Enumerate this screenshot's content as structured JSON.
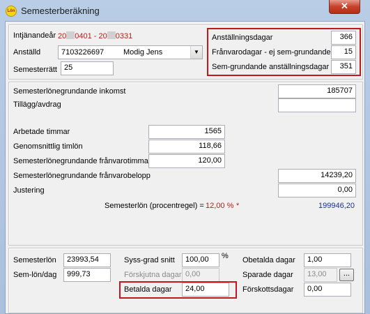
{
  "window": {
    "title": "Semesterberäkning",
    "app_icon_text": "Lön",
    "close_symbol": "✕"
  },
  "header": {
    "intjanandear_label": "Intjänandeår",
    "intjanandear_from": "20",
    "intjanandear_from_suffix": "0401",
    "intjanandear_sep": "-",
    "intjanandear_to": "20",
    "intjanandear_to_suffix": "0331",
    "anstalld_label": "Anställd",
    "anstalld_id": "7103226697",
    "anstalld_name": "Modig Jens",
    "semesterratt_label": "Semesterrätt",
    "semesterratt_value": "25"
  },
  "days": {
    "anstallningsdagar_label": "Anställningsdagar",
    "anstallningsdagar_value": "366",
    "franvarodagar_label": "Frånvarodagar - ej sem-grundande",
    "franvarodagar_value": "15",
    "semgrundande_label": "Sem-grundande anställningsdagar",
    "semgrundande_value": "351"
  },
  "income": {
    "inkomst_label": "Semesterlönegrundande inkomst",
    "inkomst_value": "185707",
    "tillagg_label": "Tillägg/avdrag",
    "tillagg_value": ""
  },
  "hours": {
    "arbetade_label": "Arbetade timmar",
    "arbetade_value": "1565",
    "timlon_label": "Genomsnittlig timlön",
    "timlon_value": "118,66",
    "franvarotimmar_label": "Semesterlönegrundande frånvarotimmar",
    "franvarotimmar_value": "120,00",
    "franvarobelopp_label": "Semesterlönegrundande frånvarobelopp",
    "franvarobelopp_value": "14239,20",
    "justering_label": "Justering",
    "justering_value": "0,00",
    "procentregel_label": "Semesterlön (procentregel) =",
    "procentregel_percent": "12,00 %",
    "procentregel_star": "*",
    "procentregel_value": "199946,20"
  },
  "summary": {
    "semesterlon_label": "Semesterlön",
    "semesterlon_value": "23993,54",
    "semlondag_label": "Sem-lön/dag",
    "semlondag_value": "999,73",
    "syssgrad_label": "Syss-grad snitt",
    "syssgrad_value": "100,00",
    "syssgrad_unit": "%",
    "forskjutna_label": "Förskjutna dagar",
    "forskjutna_value": "0,00",
    "betalda_label": "Betalda dagar",
    "betalda_value": "24,00",
    "obetalda_label": "Obetalda dagar",
    "obetalda_value": "1,00",
    "sparade_label": "Sparade dagar",
    "sparade_value": "13,00",
    "sparade_button": "...",
    "forskott_label": "Förskottsdagar",
    "forskott_value": "0,00"
  },
  "colors": {
    "highlight": "#c0191b",
    "red_text": "#b0211b",
    "blue_text": "#1a2f9c"
  }
}
